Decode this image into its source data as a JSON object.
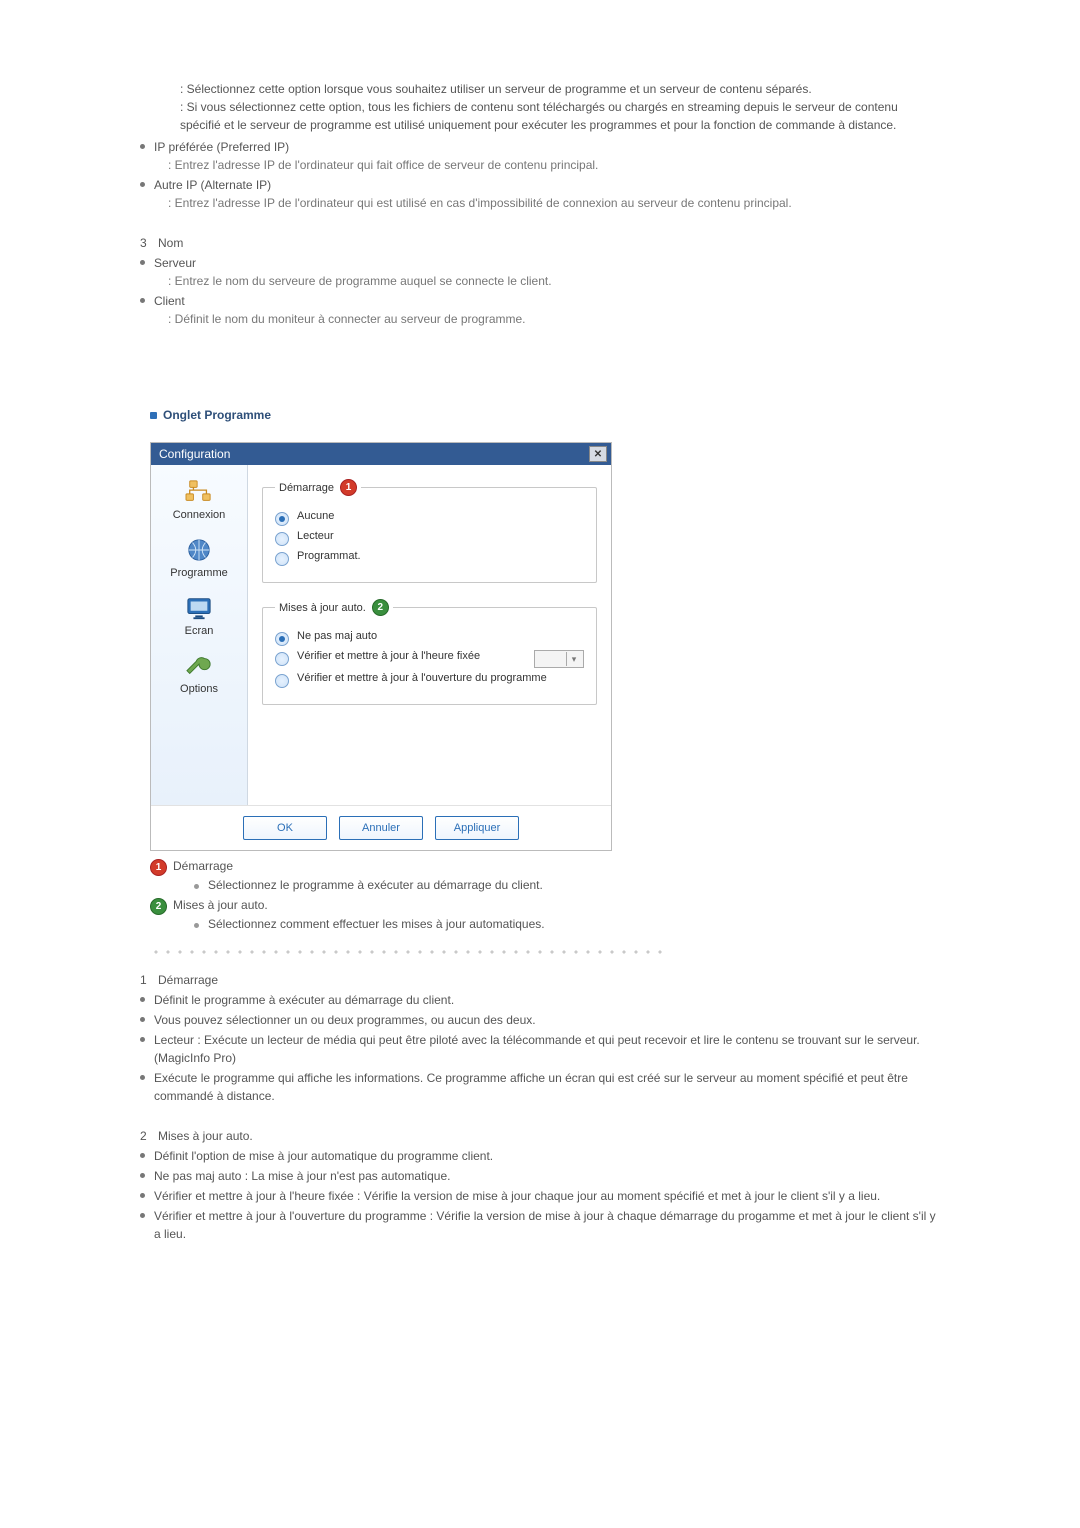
{
  "intro": {
    "line1": ": Sélectionnez cette option lorsque vous souhaitez utiliser un serveur de programme et un serveur de contenu séparés.",
    "line2": ": Si vous sélectionnez cette option, tous les fichiers de contenu sont téléchargés ou chargés en streaming depuis le serveur de contenu spécifié et le serveur de programme est utilisé uniquement pour exécuter les programmes et pour la fonction de commande à distance."
  },
  "ip": {
    "preferred_title": "IP préférée (Preferred IP)",
    "preferred_desc": ": Entrez l'adresse IP de l'ordinateur qui fait office de serveur de contenu principal.",
    "alternate_title": "Autre IP (Alternate IP)",
    "alternate_desc": ": Entrez l'adresse IP de l'ordinateur qui est utilisé en cas d'impossibilité de connexion au serveur de contenu principal."
  },
  "section3": {
    "num": "3",
    "title": "Nom",
    "server_title": "Serveur",
    "server_desc": ": Entrez le nom du serveure de programme auquel se connecte le client.",
    "client_title": "Client",
    "client_desc": ": Définit le nom du moniteur à connecter au serveur de programme."
  },
  "tab_heading": "Onglet Programme",
  "dialog": {
    "title": "Configuration",
    "close_glyph": "✕",
    "side": {
      "connexion": "Connexion",
      "programme": "Programme",
      "ecran": "Ecran",
      "options": "Options"
    },
    "group1": {
      "legend": "Démarrage",
      "badge": "1",
      "opt_none": "Aucune",
      "opt_player": "Lecteur",
      "opt_sched": "Programmat."
    },
    "group2": {
      "legend": "Mises à jour auto.",
      "badge": "2",
      "opt_none": "Ne pas maj auto",
      "opt_time": "Vérifier et mettre à jour à l'heure fixée",
      "opt_open": "Vérifier et mettre à jour à l'ouverture du programme"
    },
    "buttons": {
      "ok": "OK",
      "cancel": "Annuler",
      "apply": "Appliquer"
    }
  },
  "notes": {
    "n1_badge": "1",
    "n1_title": "Démarrage",
    "n1_sub": "Sélectionnez le programme à exécuter au démarrage du client.",
    "n2_badge": "2",
    "n2_title": "Mises à jour auto.",
    "n2_sub": "Sélectionnez comment effectuer les mises à jour automatiques."
  },
  "sec1": {
    "num": "1",
    "title": "Démarrage",
    "b1": "Définit le programme à exécuter au démarrage du client.",
    "b2": "Vous pouvez sélectionner un ou deux programmes, ou aucun des deux.",
    "b3": "Lecteur : Exécute un lecteur de média qui peut être piloté avec la télécommande et qui peut recevoir et lire le contenu se trouvant sur le serveur. (MagicInfo Pro)",
    "b4": "Exécute le programme qui affiche les informations. Ce programme affiche un écran qui est créé sur le serveur au moment spécifié et peut être commandé à distance."
  },
  "sec2": {
    "num": "2",
    "title": "Mises à jour auto.",
    "b1": "Définit l'option de mise à jour automatique du programme client.",
    "b2": "Ne pas maj auto : La mise à jour n'est pas automatique.",
    "b3": "Vérifier et mettre à jour à l'heure fixée : Vérifie la version de mise à jour chaque jour au moment spécifié et met à jour le client s'il y a lieu.",
    "b4": "Vérifier et mettre à jour à l'ouverture du programme : Vérifie la version de mise à jour à chaque démarrage du progamme et met à jour le client s'il y a lieu."
  }
}
